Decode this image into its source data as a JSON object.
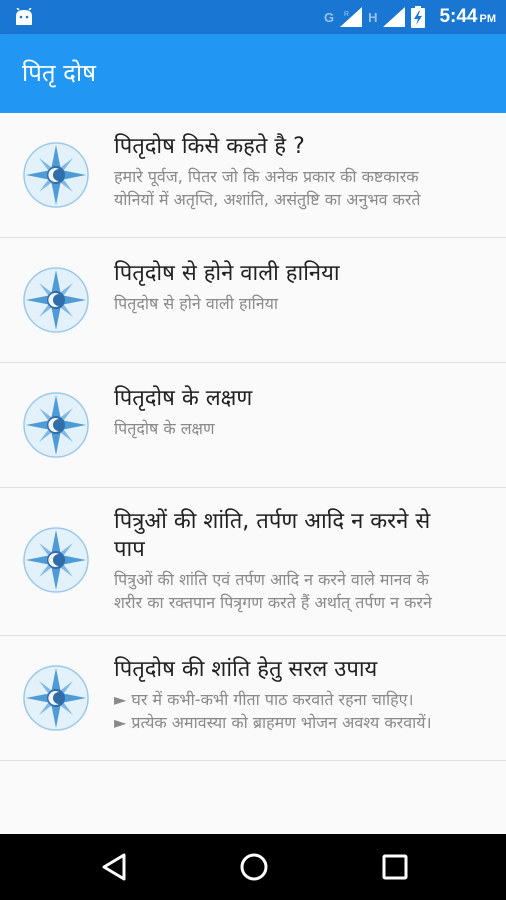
{
  "status_bar": {
    "time": "5:44",
    "ampm": "PM",
    "net1": "G",
    "net1_sup": "R",
    "net2": "H",
    "icons": [
      "android-icon",
      "signal-icon",
      "battery-charging-icon"
    ]
  },
  "app_bar": {
    "title": "पितृ दोष"
  },
  "items": [
    {
      "title": "पितृदोष किसे कहते है ?",
      "subtitle_1": "हमारे पूर्वज, पितर जो कि अनेक प्रकार की कष्टकारक",
      "subtitle_2": "योनियों में अतृप्ति, अशांति, असंतुष्टि का अनुभव करते"
    },
    {
      "title": "पितृदोष से होने वाली हानिया",
      "subtitle_1": "पितृदोष से होने वाली हानिया"
    },
    {
      "title": "पितृदोष के लक्षण",
      "subtitle_1": "पितृदोष के लक्षण"
    },
    {
      "title_1": "पित्रुओं की शांति, तर्पण आदि न करने से",
      "title_2": "पाप",
      "subtitle_1": "पित्रुओं की शांति एवं तर्पण आदि न करने वाले मानव के",
      "subtitle_2": "शरीर का रक्तपान पित्रृगण करते हैं अर्थात् तर्पण न करने"
    },
    {
      "title": "पितृदोष की शांति हेतु सरल उपाय",
      "subtitle_1": "► घर में कभी-कभी गीता पाठ करवाते रहना चाहिए।",
      "subtitle_2": "► प्रत्येक अमावस्या को ब्राहमण भोजन अवश्य करवायें।"
    }
  ],
  "colors": {
    "status_bar": "#1976d2",
    "app_bar": "#2196f3",
    "icon_light": "#cfe8f7",
    "icon_dark": "#5a9fd4"
  }
}
